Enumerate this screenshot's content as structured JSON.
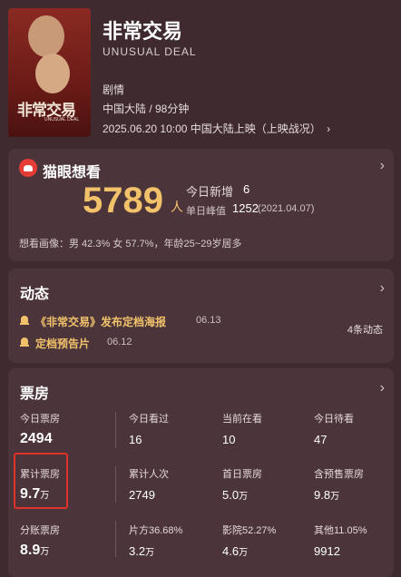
{
  "movie": {
    "title": "非常交易",
    "en_title": "UNUSUAL DEAL",
    "genre": "剧情",
    "region_duration": "中国大陆 / 98分钟",
    "release": "2025.06.20 10:00  中国大陆上映（上映战况）",
    "poster_title": "非常交易",
    "poster_sub": "UNUSUAL DEAL"
  },
  "want": {
    "title": "猫眼想看",
    "count": "5789",
    "unit": "人",
    "today_label": "今日新增",
    "today_value": "6",
    "peak_label": "单日峰值",
    "peak_value": "1252",
    "peak_date": "(2021.04.07)",
    "profile": "想看画像：男 42.3%  女 57.7%，年龄25~29岁居多"
  },
  "news": {
    "title": "动态",
    "items": [
      {
        "text": "《非常交易》发布定档海报",
        "date": "06.13"
      },
      {
        "text": "定档预告片",
        "date": "06.12"
      }
    ],
    "count_label": "4条动态"
  },
  "boxoffice": {
    "title": "票房",
    "rows": [
      [
        {
          "label": "今日票房",
          "value": "2494",
          "unit": ""
        },
        {
          "label": "今日看过",
          "value": "16",
          "unit": ""
        },
        {
          "label": "当前在看",
          "value": "10",
          "unit": ""
        },
        {
          "label": "今日待看",
          "value": "47",
          "unit": ""
        }
      ],
      [
        {
          "label": "累计票房",
          "value": "9.7",
          "unit": "万"
        },
        {
          "label": "累计人次",
          "value": "2749",
          "unit": ""
        },
        {
          "label": "首日票房",
          "value": "5.0",
          "unit": "万"
        },
        {
          "label": "含预售票房",
          "value": "9.8",
          "unit": "万"
        }
      ],
      [
        {
          "label": "分账票房",
          "value": "8.9",
          "unit": "万"
        },
        {
          "label": "片方36.68%",
          "value": "3.2",
          "unit": "万"
        },
        {
          "label": "影院52.27%",
          "value": "4.6",
          "unit": "万"
        },
        {
          "label": "其他11.05%",
          "value": "9912",
          "unit": ""
        }
      ]
    ]
  },
  "colors": {
    "background": "#3f2a30",
    "card": "#4b353b",
    "accent_gold": "#f2c26b",
    "highlight_red": "#e0322b",
    "maoyan_red": "#e53c36"
  },
  "icons": [
    "chevron-right-icon",
    "maoyan-cat-icon",
    "bell-icon"
  ]
}
